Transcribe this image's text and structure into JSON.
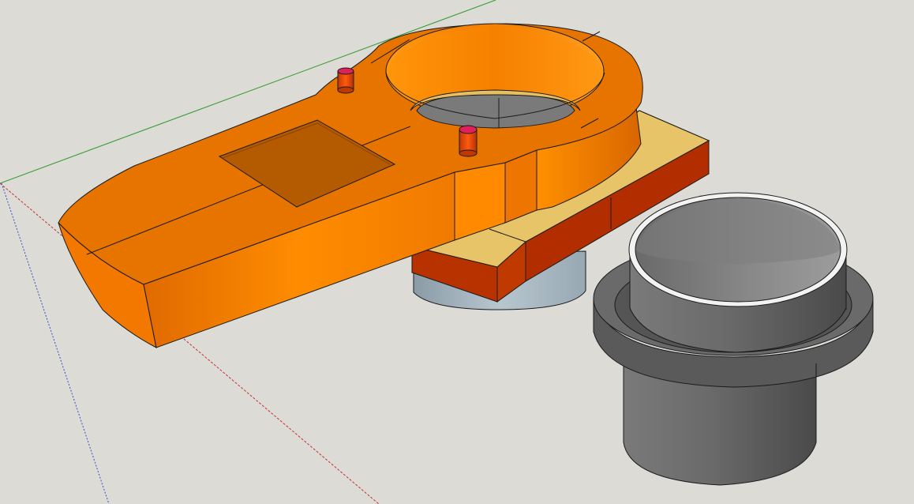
{
  "app": {
    "view": "3d-model-viewport"
  },
  "colors": {
    "background": "#dcdbd6",
    "orange_light": "#ff8c00",
    "orange_mid": "#f07800",
    "orange_dark": "#d86800",
    "orange_window": "#b45a00",
    "gasket_top": "#e6c060",
    "gasket_side": "#b83200",
    "cylinder_light": "#a9b9c3",
    "cylinder_dark": "#8fa0aa",
    "cylinder_inner": "#7a7a7a",
    "gray_light": "#8c8c8c",
    "gray_mid": "#6e6e6e",
    "gray_dark": "#4e4e4e",
    "pin_body": "#e04a00",
    "pin_top": "#e0205a",
    "axis_green": "#2e9a2e",
    "axis_red": "#c83030",
    "axis_blue": "#3050c8",
    "edge": "#1a1a1a"
  },
  "objects": [
    {
      "name": "orange-housing",
      "material": "orange"
    },
    {
      "name": "gasket-plate",
      "material": "tan-red"
    },
    {
      "name": "light-cylinder",
      "material": "light-blue-gray"
    },
    {
      "name": "gray-flanged-cup",
      "material": "gray"
    }
  ]
}
